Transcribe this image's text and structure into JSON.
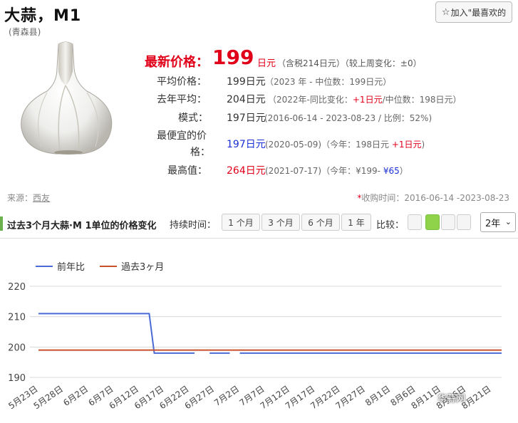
{
  "header": {
    "title": "大蒜，M1",
    "subtitle": "(青森县)",
    "favorite_label": "加入\"最喜欢的",
    "favorite_icon": "star-outline-icon"
  },
  "latest": {
    "label": "最新价格：",
    "price": "199",
    "unit": "日元",
    "note": "（含税214日元）（较上周变化：±0）"
  },
  "stats": {
    "average": {
      "label": "平均价格：",
      "value": "199日元",
      "note": "（2023 年 - 中位数：199日元）"
    },
    "last_year": {
      "label": "去年平均：",
      "value": "204日元",
      "note_a": "（2022年-同比变化：",
      "change": "+1日元",
      "note_b": "/中位数：198日元）"
    },
    "mode": {
      "label": "模式：",
      "value": "197日元",
      "note": "(2016-06-14 - 2023-08-23 / 比例：52%)"
    },
    "cheapest": {
      "label_1": "最便宜的价",
      "label_2": "格：",
      "value": "197日元",
      "note_a": "(2020-05-09)（今年：198日元",
      "change": "+1日元",
      "note_b": ")"
    },
    "highest": {
      "label": "最高值：",
      "value": "264日元",
      "note_a": "(2021-07-17)（今年：¥199-",
      "change": "¥65",
      "note_b": "）"
    }
  },
  "source": {
    "label": "来源：",
    "link": "西友"
  },
  "collect": {
    "mark": "*",
    "text": "收购时间：2016-06-14 -2023-08-23"
  },
  "section": {
    "title": "过去3个月大蒜·M 1单位的价格变化",
    "duration_label": "持续时间：",
    "durations": [
      "1 个月",
      "3 个月",
      "6 个月",
      "1 年"
    ],
    "compare_label": "比较：",
    "year_option": "2年"
  },
  "colors": {
    "series_prev_year": "#4a6bd6",
    "series_3m": "#c8502a",
    "accent_green": "#8fd34b",
    "price_red": "#e0001a"
  },
  "chart_data": {
    "type": "line",
    "title": "",
    "xlabel": "",
    "ylabel": "",
    "ylim": [
      190,
      220
    ],
    "yticks": [
      190,
      200,
      210,
      220
    ],
    "grid": true,
    "legend_position": "top-left",
    "x": [
      "5月23日",
      "5月28日",
      "6月2日",
      "6月7日",
      "6月12日",
      "6月17日",
      "6月22日",
      "6月27日",
      "7月2日",
      "7月7日",
      "7月12日",
      "7月17日",
      "7月22日",
      "7月27日",
      "8月1日",
      "8月6日",
      "8月11日",
      "8月16日",
      "8月21日"
    ],
    "series": [
      {
        "name": "前年比",
        "color": "#4a6bd6",
        "points": [
          {
            "x": "5月23日",
            "y": 211
          },
          {
            "x": "6月14日",
            "y": 211
          },
          {
            "x": "6月15日",
            "y": 198
          },
          {
            "x": "6月23日",
            "y": 198
          },
          {
            "x": "6月24日",
            "y": null
          },
          {
            "x": "6月26日",
            "y": 198
          },
          {
            "x": "6月30日",
            "y": 198
          },
          {
            "x": "7月1日",
            "y": null
          },
          {
            "x": "7月2日",
            "y": 198
          },
          {
            "x": "8月23日",
            "y": 198
          }
        ]
      },
      {
        "name": "過去3ヶ月",
        "color": "#c8502a",
        "points": [
          {
            "x": "5月23日",
            "y": 199
          },
          {
            "x": "8月23日",
            "y": 199
          }
        ]
      }
    ]
  },
  "watermark": "华蒜网"
}
